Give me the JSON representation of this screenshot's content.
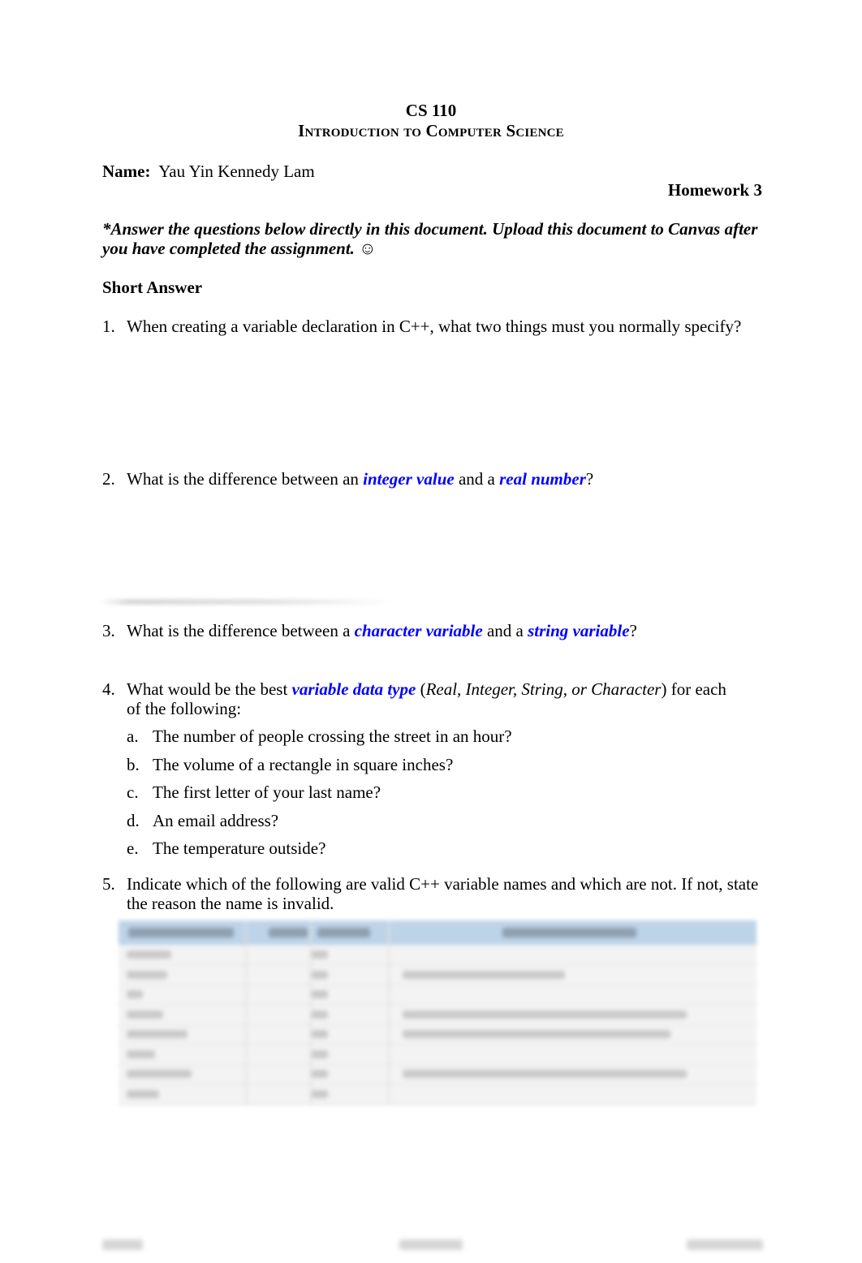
{
  "header": {
    "course": "CS 110",
    "course_title": "Introduction to Computer Science",
    "name_label": "Name:",
    "name_value": "Yau Yin Kennedy Lam",
    "assignment": "Homework 3"
  },
  "instructions": "*Answer the questions below directly in this document.  Upload this document to Canvas after you have completed the assignment. ☺",
  "section_heading": "Short Answer",
  "questions": [
    {
      "number": "1.",
      "parts": [
        {
          "text": "When creating a variable declaration in C++, what two things must you normally specify?",
          "style": "normal"
        }
      ]
    },
    {
      "number": "2.",
      "parts": [
        {
          "text": "What is the difference between an ",
          "style": "normal"
        },
        {
          "text": "integer value",
          "style": "keyword"
        },
        {
          "text": " and a ",
          "style": "normal"
        },
        {
          "text": "real number",
          "style": "keyword"
        },
        {
          "text": "?",
          "style": "normal"
        }
      ]
    },
    {
      "number": "3.",
      "parts": [
        {
          "text": "What is the difference between a ",
          "style": "normal"
        },
        {
          "text": "character variable",
          "style": "keyword"
        },
        {
          "text": " and a ",
          "style": "normal"
        },
        {
          "text": "string variable",
          "style": "keyword"
        },
        {
          "text": "?",
          "style": "normal"
        }
      ]
    },
    {
      "number": "4.",
      "parts": [
        {
          "text": "What would be the best ",
          "style": "normal"
        },
        {
          "text": "variable data type",
          "style": "keyword"
        },
        {
          "text": " (",
          "style": "normal"
        },
        {
          "text": "Real, Integer, String, or Character",
          "style": "italic"
        },
        {
          "text": ") for each of the following:",
          "style": "normal"
        }
      ],
      "sub_items": [
        {
          "letter": "a.",
          "text": "The number of people crossing the street in an hour?"
        },
        {
          "letter": "b.",
          "text": "The volume of a rectangle in square inches?"
        },
        {
          "letter": "c.",
          "text": "The first letter of your last name?"
        },
        {
          "letter": "d.",
          "text": "An email address?"
        },
        {
          "letter": "e.",
          "text": "The temperature outside?"
        }
      ]
    },
    {
      "number": "5.",
      "parts": [
        {
          "text": "Indicate which of the following are valid C++ variable names and which are not.  If not, state the reason the name is invalid.",
          "style": "normal"
        }
      ]
    }
  ],
  "variable_table": {
    "blurred": true,
    "row_count": 8
  },
  "colors": {
    "keyword": "#0000ff",
    "table_header": "#bcd3e8",
    "table_body": "#f3f3f3"
  }
}
